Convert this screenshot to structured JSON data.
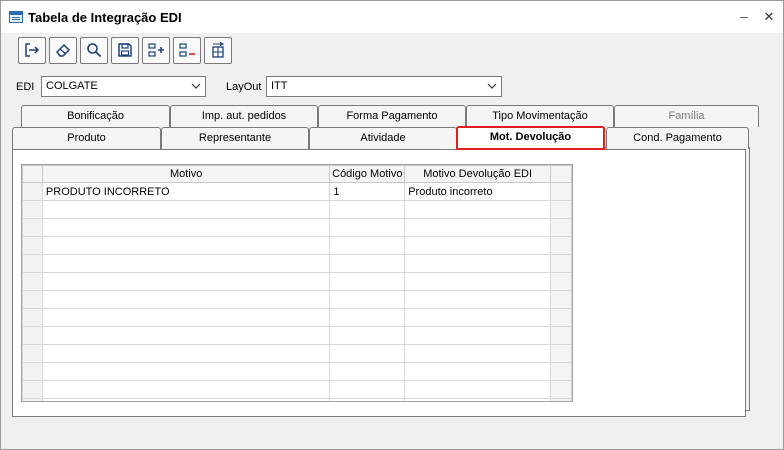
{
  "window": {
    "title": "Tabela de Integração EDI",
    "min_symbol": "‒",
    "close_symbol": "✕"
  },
  "toolbar": [
    {
      "name": "exit-icon"
    },
    {
      "name": "eraser-icon"
    },
    {
      "name": "search-icon"
    },
    {
      "name": "save-icon"
    },
    {
      "name": "add-row-icon"
    },
    {
      "name": "remove-row-icon"
    },
    {
      "name": "table-icon"
    }
  ],
  "filters": {
    "edi_label": "EDI",
    "edi_value": "COLGATE",
    "layout_label": "LayOut",
    "layout_value": "ITT"
  },
  "tabs_row1": [
    "Bonificação",
    "Imp. aut. pedidos",
    "Forma Pagamento",
    "Tipo Movimentação",
    "Família"
  ],
  "tabs_row2": [
    "Produto",
    "Representante",
    "Atividade",
    "Mot. Devolução",
    "Cond. Pagamento"
  ],
  "active_tab": "Mot. Devolução",
  "disabled_tab": "Família",
  "grid": {
    "columns": [
      "Motivo",
      "Código Motivo",
      "Motivo Devolução EDI"
    ],
    "rows": [
      [
        "PRODUTO INCORRETO",
        "1",
        "Produto incorreto"
      ]
    ]
  },
  "colors": {
    "highlight": "#e02020",
    "border": "#7a7a7a",
    "window_bg": "#f0f0f0"
  }
}
